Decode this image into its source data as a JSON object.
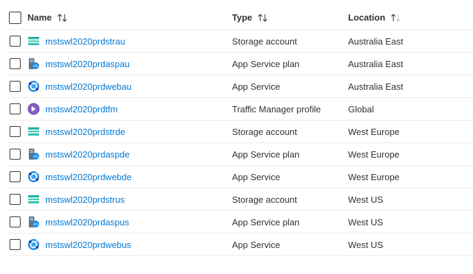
{
  "columns": {
    "name": "Name",
    "type": "Type",
    "location": "Location"
  },
  "rows": [
    {
      "name": "mstswl2020prdstrau",
      "type": "Storage account",
      "location": "Australia East",
      "icon": "storage-account-icon"
    },
    {
      "name": "mstswl2020prdaspau",
      "type": "App Service plan",
      "location": "Australia East",
      "icon": "app-service-plan-icon"
    },
    {
      "name": "mstswl2020prdwebau",
      "type": "App Service",
      "location": "Australia East",
      "icon": "app-service-icon"
    },
    {
      "name": "mstswl2020prdtfm",
      "type": "Traffic Manager profile",
      "location": "Global",
      "icon": "traffic-manager-icon"
    },
    {
      "name": "mstswl2020prdstrde",
      "type": "Storage account",
      "location": "West Europe",
      "icon": "storage-account-icon"
    },
    {
      "name": "mstswl2020prdaspde",
      "type": "App Service plan",
      "location": "West Europe",
      "icon": "app-service-plan-icon"
    },
    {
      "name": "mstswl2020prdwebde",
      "type": "App Service",
      "location": "West Europe",
      "icon": "app-service-icon"
    },
    {
      "name": "mstswl2020prdstrus",
      "type": "Storage account",
      "location": "West US",
      "icon": "storage-account-icon"
    },
    {
      "name": "mstswl2020prdaspus",
      "type": "App Service plan",
      "location": "West US",
      "icon": "app-service-plan-icon"
    },
    {
      "name": "mstswl2020prdwebus",
      "type": "App Service",
      "location": "West US",
      "icon": "app-service-icon"
    }
  ],
  "colors": {
    "link": "#0078d4",
    "text": "#323130",
    "border": "#edebe9"
  }
}
